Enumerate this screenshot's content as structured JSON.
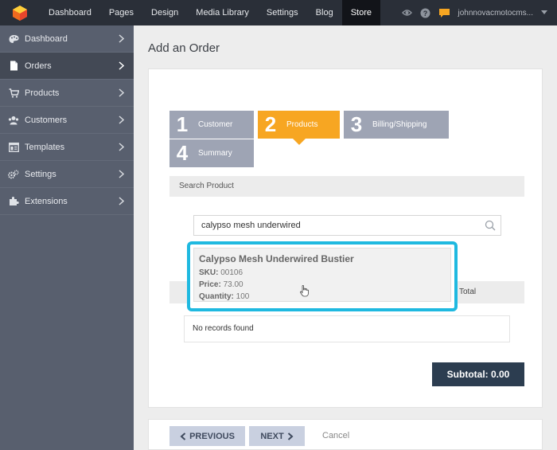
{
  "topnav": {
    "items": [
      "Dashboard",
      "Pages",
      "Design",
      "Media Library",
      "Settings",
      "Blog",
      "Store"
    ],
    "active": "Store",
    "user": "johnnovacmotocms..."
  },
  "sidebar": {
    "items": [
      {
        "label": "Dashboard",
        "icon": "palette-icon"
      },
      {
        "label": "Orders",
        "icon": "document-icon"
      },
      {
        "label": "Products",
        "icon": "cart-icon"
      },
      {
        "label": "Customers",
        "icon": "users-icon"
      },
      {
        "label": "Templates",
        "icon": "template-icon"
      },
      {
        "label": "Settings",
        "icon": "gears-icon"
      },
      {
        "label": "Extensions",
        "icon": "puzzle-icon"
      }
    ],
    "active": "Orders"
  },
  "page": {
    "title": "Add an Order"
  },
  "steps": [
    {
      "num": "1",
      "label": "Customer"
    },
    {
      "num": "2",
      "label": "Products"
    },
    {
      "num": "3",
      "label": "Billing/Shipping"
    },
    {
      "num": "4",
      "label": "Summary"
    }
  ],
  "search": {
    "heading": "Search Product",
    "value": "calypso mesh underwired"
  },
  "result": {
    "name": "Calypso Mesh Underwired Bustier",
    "sku_label": "SKU:",
    "sku": "00106",
    "price_label": "Price:",
    "price": "73.00",
    "qty_label": "Quantity:",
    "qty": "100"
  },
  "table": {
    "total_header": "Total",
    "empty": "No records found"
  },
  "subtotal": "Subtotal: 0.00",
  "footer": {
    "prev": "PREVIOUS",
    "next": "NEXT",
    "cancel": "Cancel"
  },
  "colors": {
    "accent": "#f7a622",
    "highlight": "#1fb9e0",
    "sidebar": "#585f6e",
    "topbar": "#2a2f38"
  }
}
